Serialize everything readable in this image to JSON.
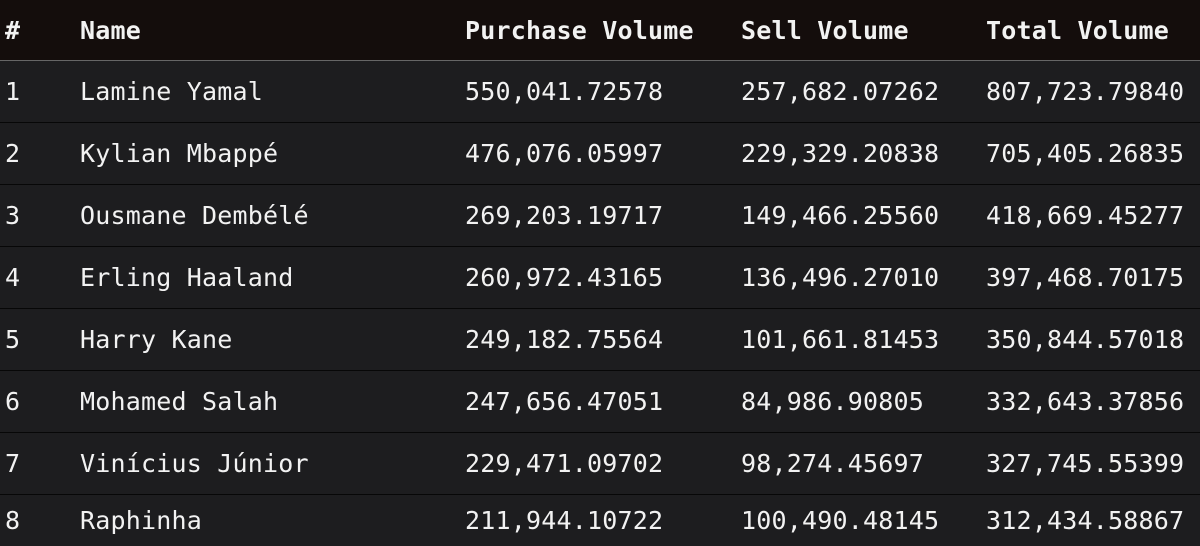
{
  "table": {
    "headers": {
      "rank": "#",
      "name": "Name",
      "purchase": "Purchase Volume",
      "sell": "Sell Volume",
      "total": "Total Volume"
    },
    "rows": [
      {
        "rank": "1",
        "name": "Lamine Yamal",
        "purchase": "550,041.72578",
        "sell": "257,682.07262",
        "total": "807,723.79840"
      },
      {
        "rank": "2",
        "name": "Kylian Mbappé",
        "purchase": "476,076.05997",
        "sell": "229,329.20838",
        "total": "705,405.26835"
      },
      {
        "rank": "3",
        "name": "Ousmane Dembélé",
        "purchase": "269,203.19717",
        "sell": "149,466.25560",
        "total": "418,669.45277"
      },
      {
        "rank": "4",
        "name": "Erling Haaland",
        "purchase": "260,972.43165",
        "sell": "136,496.27010",
        "total": "397,468.70175"
      },
      {
        "rank": "5",
        "name": "Harry Kane",
        "purchase": "249,182.75564",
        "sell": "101,661.81453",
        "total": "350,844.57018"
      },
      {
        "rank": "6",
        "name": "Mohamed Salah",
        "purchase": "247,656.47051",
        "sell": "84,986.90805",
        "total": "332,643.37856"
      },
      {
        "rank": "7",
        "name": "Vinícius Júnior",
        "purchase": "229,471.09702",
        "sell": "98,274.45697",
        "total": "327,745.55399"
      },
      {
        "rank": "8",
        "name": "Raphinha",
        "purchase": "211,944.10722",
        "sell": "100,490.48145",
        "total": "312,434.58867"
      }
    ]
  }
}
